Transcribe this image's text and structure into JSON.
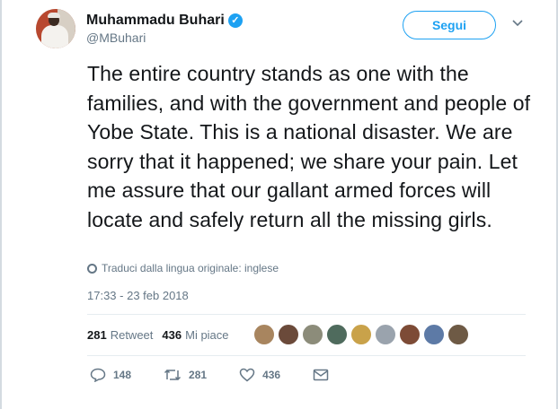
{
  "user": {
    "display_name": "Muhammadu Buhari",
    "handle": "@MBuhari",
    "verified_icon": "verified-badge-icon",
    "avatar_icon": "avatar-photo"
  },
  "follow_button": {
    "label": "Segui"
  },
  "menu": {
    "icon": "chevron-down-icon"
  },
  "tweet": {
    "text": "The entire country stands as one with the families, and with the government and people of Yobe State. This is a national disaster. We are sorry that it happened; we share your pain. Let me assure that our gallant armed forces will locate and safely return all the missing girls.",
    "translate_label": "Traduci dalla lingua originale: inglese",
    "timestamp": "17:33 - 23 feb 2018"
  },
  "stats": {
    "retweets_count": "281",
    "retweets_label": "Retweet",
    "likes_count": "436",
    "likes_label": "Mi piace"
  },
  "likers": [
    {
      "name": "liker-avatar-1",
      "color": "#a8855f"
    },
    {
      "name": "liker-avatar-2",
      "color": "#6b4a3a"
    },
    {
      "name": "liker-avatar-3",
      "color": "#8c8c7a"
    },
    {
      "name": "liker-avatar-4",
      "color": "#4f6b5d"
    },
    {
      "name": "liker-avatar-5",
      "color": "#c9a24a"
    },
    {
      "name": "liker-avatar-6",
      "color": "#9aa3ad"
    },
    {
      "name": "liker-avatar-7",
      "color": "#7d4b36"
    },
    {
      "name": "liker-avatar-8",
      "color": "#5d7aa6"
    },
    {
      "name": "liker-avatar-9",
      "color": "#6e5a45"
    }
  ],
  "actions": {
    "reply_count": "148",
    "retweet_count": "281",
    "like_count": "436"
  },
  "colors": {
    "accent": "#1da1f2",
    "text": "#14171a",
    "muted": "#657786"
  }
}
